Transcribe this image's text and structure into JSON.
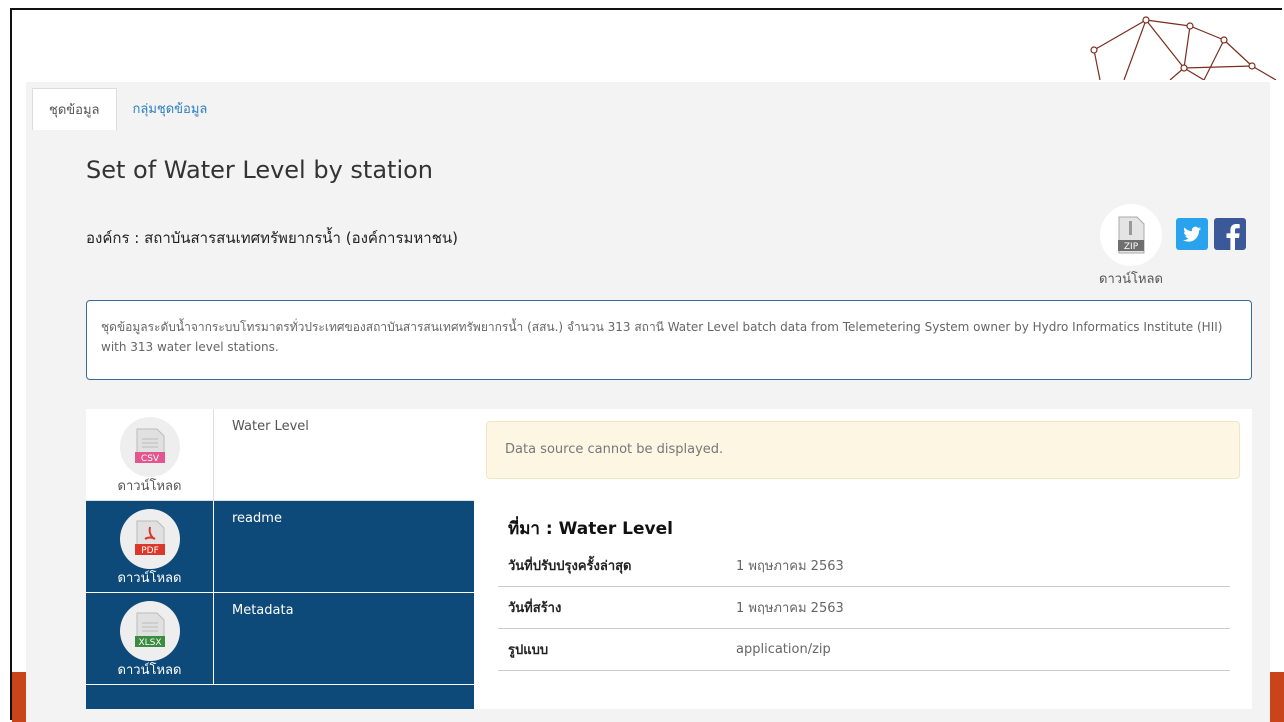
{
  "tabs": [
    {
      "label": "ชุดข้อมูล",
      "active": true
    },
    {
      "label": "กลุ่มชุดข้อมูล",
      "active": false
    }
  ],
  "dataset": {
    "title": "Set of Water Level by station",
    "organization": "องค์กร : สถาบันสารสนเทศทรัพยากรน้ำ (องค์การมหาชน)",
    "description": "ชุดข้อมูลระดับน้ำจากระบบโทรมาตรทั่วประเทศของสถาบันสารสนเทศทรัพยากรน้ำ (สสน.) จำนวน 313 สถานี Water Level batch data from Telemetering System owner by Hydro Informatics Institute (HII) with 313 water level stations."
  },
  "download_all": {
    "format": "ZIP",
    "label": "ดาวน์โหลด"
  },
  "social": [
    {
      "name": "twitter-icon"
    },
    {
      "name": "facebook-icon"
    }
  ],
  "files": [
    {
      "format": "CSV",
      "download_label": "ดาวน์โหลด",
      "name": "Water Level",
      "selected": true,
      "badge_color": "#e3558f"
    },
    {
      "format": "PDF",
      "download_label": "ดาวน์โหลด",
      "name": "readme",
      "selected": false,
      "badge_color": "#d9382a"
    },
    {
      "format": "XLSX",
      "download_label": "ดาวน์โหลด",
      "name": "Metadata",
      "selected": false,
      "badge_color": "#3a8c3f"
    }
  ],
  "preview": {
    "alert": "Data source cannot be displayed.",
    "source_title": "ที่มา : Water Level",
    "meta": [
      {
        "key": "วันที่ปรับปรุงครั้งล่าสุด",
        "value": "1 พฤษภาคม 2563"
      },
      {
        "key": "วันที่สร้าง",
        "value": "1 พฤษภาคม 2563"
      },
      {
        "key": "รูปแบบ",
        "value": "application/zip"
      }
    ]
  },
  "colors": {
    "accent": "#0d4a7a",
    "link": "#2d7fc0",
    "alert_bg": "#fcf6e3",
    "slide_accent": "#c8451c"
  }
}
